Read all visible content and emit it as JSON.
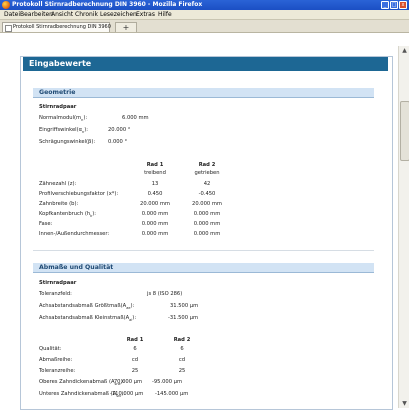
{
  "window": {
    "title": "Protokoll Stirnradberechnung DIN 3960 - Mozilla Firefox",
    "buttons": [
      "_",
      "□",
      "x"
    ]
  },
  "menu": [
    "Datei",
    "Bearbeiten",
    "Ansicht",
    "Chronik",
    "Lesezeichen",
    "Extras",
    "Hilfe"
  ],
  "tab": {
    "label": "Protokoll Stirnradberechnung DIN 3960",
    "new_tab": "+"
  },
  "scrollbar": {
    "up": "▲",
    "down": "▼"
  },
  "page": {
    "title": "Eingabewerte",
    "geometrie": {
      "heading": "Geometrie",
      "sub": "Stirnradpaar",
      "modul": {
        "label": "Normalmodul(m",
        "sub": "n",
        "tail": "):",
        "value": "6.000 mm"
      },
      "eingriff": {
        "label": "Eingriffswinkel(α",
        "sub": "n",
        "tail": "):",
        "value": "20.000 °"
      },
      "schraeg": {
        "label": "Schrägungswinkel(β):",
        "value": "0.000 °"
      },
      "col1": "Rad 1",
      "col1sub": "treibend",
      "col2": "Rad 2",
      "col2sub": "getrieben",
      "rows": [
        {
          "label": "Zähnezahl (z):",
          "v1": "13",
          "v2": "42"
        },
        {
          "label": "Profilverschiebungsfaktor (x*):",
          "v1": "0.450",
          "v2": "-0.450"
        },
        {
          "label": "Zahnbreite (b):",
          "v1": "20.000 mm",
          "v2": "20.000 mm"
        },
        {
          "label": "Kopfkantenbruch (h",
          "sub": "k",
          "tail": "):",
          "v1": "0.000 mm",
          "v2": "0.000 mm"
        },
        {
          "label": "Fase:",
          "v1": "0.000 mm",
          "v2": "0.000 mm"
        },
        {
          "label": "Innen-/Außendurchmesser:",
          "v1": "0.000 mm",
          "v2": "0.000 mm"
        }
      ]
    },
    "abmasse": {
      "heading": "Abmaße und Qualität",
      "sub": "Stirnradpaar",
      "toleranzfeld": {
        "label": "Toleranzfeld:",
        "value": "js 8 (ISO 286)"
      },
      "groesst": {
        "label": "Achsabstandsabmaß Größtmaß(A",
        "sub": "ae",
        "tail": "):",
        "value": "31.500 µm"
      },
      "kleinst": {
        "label": "Achsabstandsabmaß Kleinstmaß(A",
        "sub": "ai",
        "tail": "):",
        "value": "-31.500 µm"
      },
      "col1": "Rad 1",
      "col2": "Rad 2",
      "rows": [
        {
          "label": "Qualität:",
          "v1": "6",
          "v2": "6"
        },
        {
          "label": "Abmaßreihe:",
          "v1": "cd",
          "v2": "cd"
        },
        {
          "label": "Toleranzreihe:",
          "v1": "25",
          "v2": "25"
        },
        {
          "label": "Oberes Zahndickenabmaß (A",
          "sub": "sne",
          "tail": "):",
          "v1": "-70.000 µm",
          "v2": "-95.000 µm"
        },
        {
          "label": "Unteres Zahndickenabmaß (A",
          "sub": "sni",
          "tail": "):",
          "v1": "-110.000 µm",
          "v2": "-145.000 µm"
        }
      ]
    }
  }
}
